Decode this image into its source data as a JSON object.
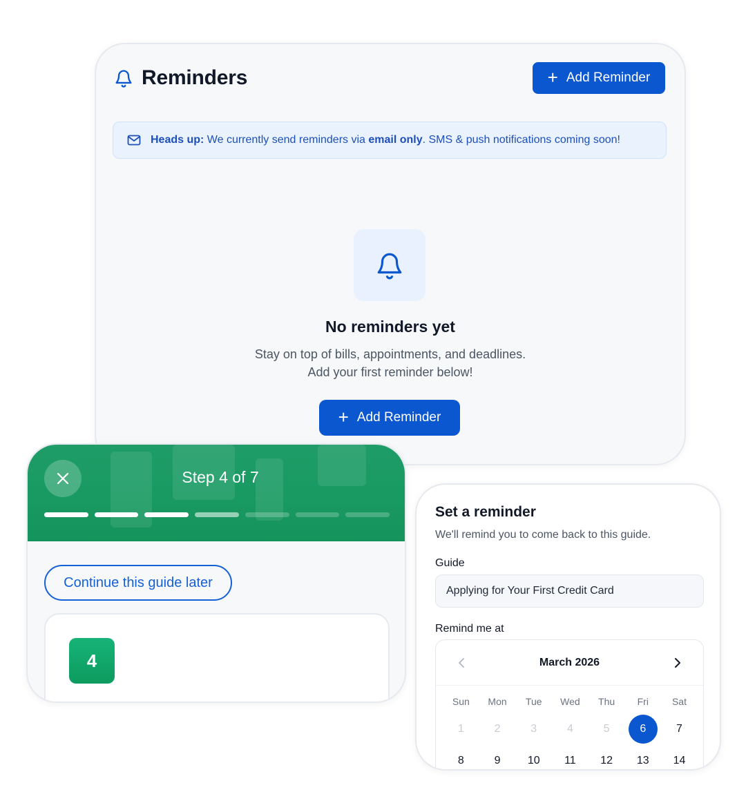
{
  "reminders": {
    "title": "Reminders",
    "add_button": "Add Reminder",
    "notice": {
      "label": "Heads up:",
      "text_before": " We currently send reminders via ",
      "emphasis": "email only",
      "text_after": ". SMS & push notifications coming soon!"
    },
    "empty_title": "No reminders yet",
    "empty_line1": "Stay on top of bills, appointments, and deadlines.",
    "empty_line2": "Add your first reminder below!",
    "empty_add_button": "Add Reminder"
  },
  "guide": {
    "step_label": "Step 4 of 7",
    "progress": {
      "completed": 3,
      "current": 4,
      "total": 7
    },
    "continue_later": "Continue this guide later",
    "step_number": "4"
  },
  "set_reminder": {
    "title": "Set a reminder",
    "subtitle": "We'll remind you to come back to this guide.",
    "guide_label": "Guide",
    "guide_value": "Applying for Your First Credit Card",
    "remind_label": "Remind me at",
    "calendar": {
      "month": "March 2026",
      "weekdays": [
        "Sun",
        "Mon",
        "Tue",
        "Wed",
        "Thu",
        "Fri",
        "Sat"
      ],
      "week1": [
        "1",
        "2",
        "3",
        "4",
        "5",
        "6",
        "7"
      ],
      "week2": [
        "8",
        "9",
        "10",
        "11",
        "12",
        "13",
        "14"
      ],
      "selected": "6"
    }
  },
  "colors": {
    "primary": "#0b57d0",
    "guide_green": "#1a9a63",
    "notice_bg": "#eaf3fd"
  }
}
